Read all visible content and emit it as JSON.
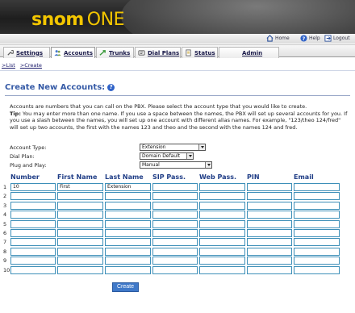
{
  "brand": {
    "name_part1": "snom",
    "name_part2": "ONE"
  },
  "toplinks": {
    "home": "Home",
    "help": "Help",
    "logout": "Logout"
  },
  "tabs": [
    {
      "label": "Settings",
      "icon": "wrench-icon"
    },
    {
      "label": "Accounts",
      "icon": "users-icon"
    },
    {
      "label": "Trunks",
      "icon": "trunk-icon"
    },
    {
      "label": "Dial Plans",
      "icon": "dialplan-icon"
    },
    {
      "label": "Status",
      "icon": "status-icon"
    },
    {
      "label": "Admin",
      "icon": ""
    }
  ],
  "subnav": {
    "list": "List",
    "create": "Create"
  },
  "page": {
    "title": "Create New Accounts:",
    "intro_line1": "Accounts are numbers that you can call on the PBX. Please select the account type that you would like to create.",
    "tip_label": "Tip:",
    "tip_text": " You may enter more than one name. If you use a space between the names, the PBX will set up several accounts for you. If you use a slash between the names, you will set up one account with different alias names. For example, \"123/theo 124/fred\" will set up two accounts, the first with the names 123 and theo and the second with the names 124 and fred."
  },
  "form": {
    "account_type_label": "Account Type:",
    "account_type_value": "Extension",
    "dial_plan_label": "Dial Plan:",
    "dial_plan_value": "Domain Default",
    "plug_play_label": "Plug and Play:",
    "plug_play_value": "Manual"
  },
  "table": {
    "columns": [
      "Number",
      "First Name",
      "Last Name",
      "SIP Pass.",
      "Web Pass.",
      "PIN",
      "Email"
    ],
    "rows": [
      [
        "10",
        "First",
        "Extension",
        "",
        "",
        "",
        ""
      ],
      [
        "",
        "",
        "",
        "",
        "",
        "",
        ""
      ],
      [
        "",
        "",
        "",
        "",
        "",
        "",
        ""
      ],
      [
        "",
        "",
        "",
        "",
        "",
        "",
        ""
      ],
      [
        "",
        "",
        "",
        "",
        "",
        "",
        ""
      ],
      [
        "",
        "",
        "",
        "",
        "",
        "",
        ""
      ],
      [
        "",
        "",
        "",
        "",
        "",
        "",
        ""
      ],
      [
        "",
        "",
        "",
        "",
        "",
        "",
        ""
      ],
      [
        "",
        "",
        "",
        "",
        "",
        "",
        ""
      ],
      [
        "",
        "",
        "",
        "",
        "",
        "",
        ""
      ]
    ],
    "row_numbers": [
      "1",
      "2",
      "3",
      "4",
      "5",
      "6",
      "7",
      "8",
      "9",
      "10"
    ]
  },
  "create_button": "Create",
  "colors": {
    "accent": "#355aa6",
    "header_bg": "#2a2a2a",
    "brand_yellow": "#f3c600",
    "field_border": "#3d8fb8"
  }
}
